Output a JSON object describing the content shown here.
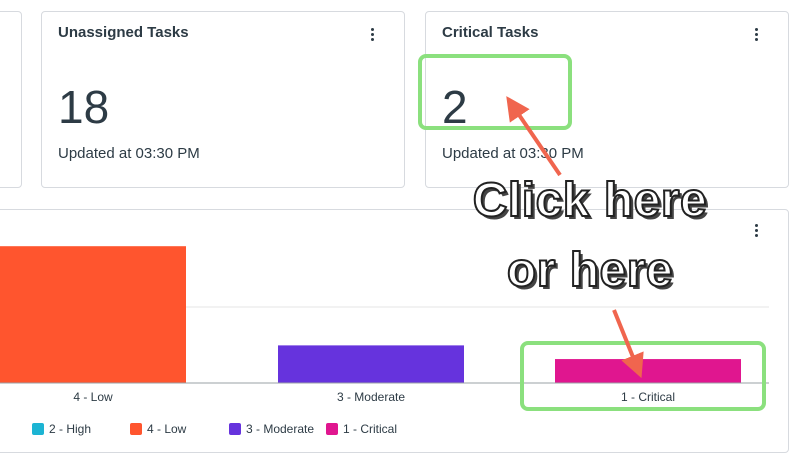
{
  "cards": {
    "unassigned": {
      "title": "Unassigned Tasks",
      "count": "18",
      "updated": "Updated at 03:30 PM"
    },
    "critical": {
      "title": "Critical Tasks",
      "count": "2",
      "updated": "Updated at 03:30 PM"
    }
  },
  "annotation": {
    "line1": "Click here",
    "line2": "or here"
  },
  "colors": {
    "high": "#1cb4d3",
    "low": "#ff552e",
    "moderate": "#6633dd",
    "critical": "#e0168f",
    "highlight": "#8be07e",
    "arrow": "#f0654e"
  },
  "icons": {
    "card_menu": "kebab-menu-icon",
    "arrow": "arrow-icon"
  },
  "chart_data": {
    "type": "bar",
    "categories": [
      "4 - Low",
      "3 - Moderate",
      "1 - Critical"
    ],
    "values": [
      8,
      2.2,
      1.4
    ],
    "ylim": [
      0,
      10
    ],
    "legend": [
      "2 - High",
      "4 - Low",
      "3 - Moderate",
      "1 - Critical"
    ],
    "legend_placement": "bottom",
    "grid": true
  }
}
